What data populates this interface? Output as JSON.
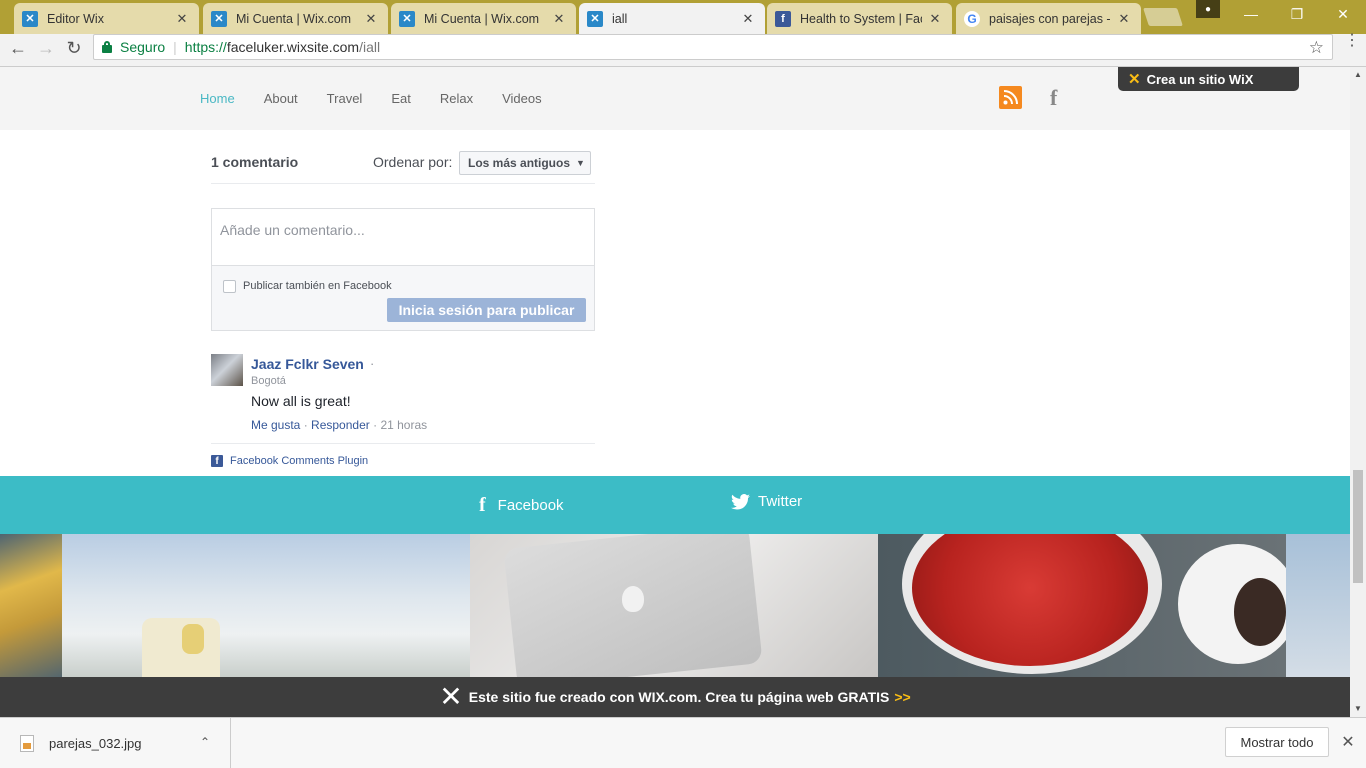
{
  "browser": {
    "tabs": [
      {
        "title": "Editor Wix",
        "icon": "wix-favicon",
        "active": false
      },
      {
        "title": "Mi Cuenta | Wix.com",
        "icon": "wix-favicon",
        "active": false
      },
      {
        "title": "Mi Cuenta | Wix.com",
        "icon": "wix-favicon",
        "active": false
      },
      {
        "title": "iall",
        "icon": "wix-favicon",
        "active": true
      },
      {
        "title": "Health to System | Faceb",
        "icon": "facebook-favicon",
        "active": false
      },
      {
        "title": "paisajes con parejas - G",
        "icon": "google-favicon",
        "active": false
      }
    ],
    "address": {
      "secure_label": "Seguro",
      "url_scheme": "https://",
      "url_host": "faceluker.wixsite.com",
      "url_path": "/iall"
    }
  },
  "site": {
    "nav": [
      "Home",
      "About",
      "Travel",
      "Eat",
      "Relax",
      "Videos"
    ],
    "nav_active": "Home",
    "wix_badge": "Crea un sitio WiX",
    "social_icons": [
      "rss-icon",
      "facebook-icon"
    ]
  },
  "comments": {
    "count_label": "1 comentario",
    "order_label": "Ordenar por:",
    "order_value": "Los más antiguos",
    "placeholder": "Añade un comentario...",
    "also_facebook": "Publicar también en Facebook",
    "post_button": "Inicia sesión para publicar",
    "items": [
      {
        "author": "Jaaz Fclkr Seven",
        "location": "Bogotá",
        "text": "Now all is great!",
        "like": "Me gusta",
        "reply": "Responder",
        "time": "21 horas"
      }
    ],
    "plugin_label": "Facebook Comments Plugin"
  },
  "social_strip": {
    "facebook": "Facebook",
    "twitter": "Twitter",
    "color": "#3cbcc6"
  },
  "wix_footer": {
    "text": "Este sitio fue creado con WIX.com. Crea tu página web GRATIS",
    "arrows": ">>"
  },
  "downloads": {
    "file": "parejas_032.jpg",
    "show_all": "Mostrar todo"
  }
}
